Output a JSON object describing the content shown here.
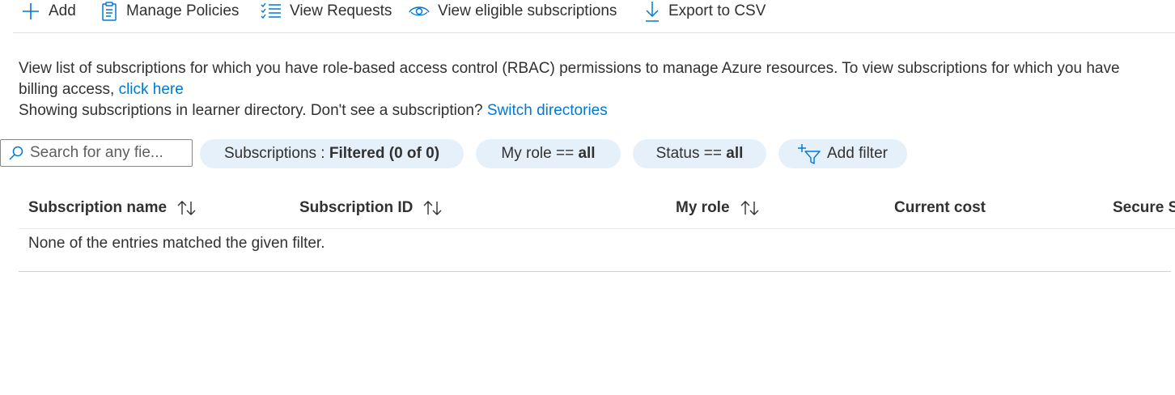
{
  "toolbar": {
    "add_label": "Add",
    "manage_policies_label": "Manage Policies",
    "view_requests_label": "View Requests",
    "view_eligible_label": "View eligible subscriptions",
    "export_label": "Export to CSV"
  },
  "description": {
    "line1": "View list of subscriptions for which you have role-based access control (RBAC) permissions to manage Azure resources. To view subscriptions for which you have billing access, ",
    "billing_link": "click here",
    "line2": "Showing subscriptions in learner directory. Don't see a subscription? ",
    "switch_link": "Switch directories"
  },
  "filters": {
    "search_placeholder": "Search for any fie...",
    "subscriptions_label": "Subscriptions : ",
    "subscriptions_value": "Filtered (0 of 0)",
    "role_label": "My role == ",
    "role_value": "all",
    "status_label": "Status == ",
    "status_value": "all",
    "add_filter_label": "Add filter"
  },
  "table": {
    "columns": [
      "Subscription name",
      "Subscription ID",
      "My role",
      "Current cost",
      "Secure S"
    ],
    "empty_message": "None of the entries matched the given filter."
  },
  "colors": {
    "accent": "#0078d4",
    "pill_bg": "#e6f0fb",
    "text": "#323130"
  }
}
